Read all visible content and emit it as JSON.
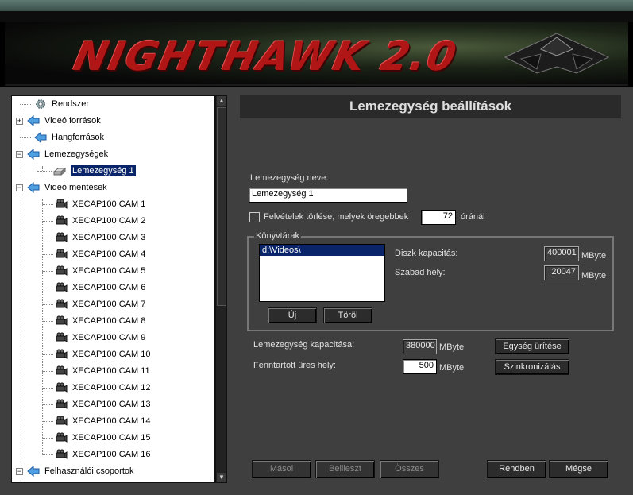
{
  "app": {
    "banner_title": "NIGHTHAWK 2.0"
  },
  "tree": {
    "items": [
      {
        "label": "Rendszer",
        "icon": "gear-icon",
        "expander": ""
      },
      {
        "label": "Videó források",
        "icon": "arrow-left-icon",
        "expander": "+"
      },
      {
        "label": "Hangforrások",
        "icon": "arrow-left-icon",
        "expander": ""
      },
      {
        "label": "Lemezegységek",
        "icon": "arrow-left-icon",
        "expander": "−"
      },
      {
        "label": "Lemezegység 1",
        "icon": "disk-icon",
        "expander": "",
        "selected": true
      },
      {
        "label": "Videó mentések",
        "icon": "arrow-left-icon",
        "expander": "−"
      },
      {
        "label": "XECAP100 CAM 1",
        "icon": "camera-icon"
      },
      {
        "label": "XECAP100 CAM 2",
        "icon": "camera-icon"
      },
      {
        "label": "XECAP100 CAM 3",
        "icon": "camera-icon"
      },
      {
        "label": "XECAP100 CAM 4",
        "icon": "camera-icon"
      },
      {
        "label": "XECAP100 CAM 5",
        "icon": "camera-icon"
      },
      {
        "label": "XECAP100 CAM 6",
        "icon": "camera-icon"
      },
      {
        "label": "XECAP100 CAM 7",
        "icon": "camera-icon"
      },
      {
        "label": "XECAP100 CAM 8",
        "icon": "camera-icon"
      },
      {
        "label": "XECAP100 CAM 9",
        "icon": "camera-icon"
      },
      {
        "label": "XECAP100 CAM 10",
        "icon": "camera-icon"
      },
      {
        "label": "XECAP100 CAM 11",
        "icon": "camera-icon"
      },
      {
        "label": "XECAP100 CAM 12",
        "icon": "camera-icon"
      },
      {
        "label": "XECAP100 CAM 13",
        "icon": "camera-icon"
      },
      {
        "label": "XECAP100 CAM 14",
        "icon": "camera-icon"
      },
      {
        "label": "XECAP100 CAM 15",
        "icon": "camera-icon"
      },
      {
        "label": "XECAP100 CAM 16",
        "icon": "camera-icon"
      },
      {
        "label": "Felhasználói csoportok",
        "icon": "arrow-left-icon",
        "expander": "−"
      }
    ]
  },
  "settings": {
    "header": "Lemezegység beállítások",
    "name_label": "Lemezegység neve:",
    "name_value": "Lemezegység 1",
    "delete_label": "Felvételek törlése, melyek öregebbek",
    "delete_hours": "72",
    "delete_unit": "óránál",
    "group_title": "Könyvtárak",
    "directories": [
      "d:\\Videos\\"
    ],
    "disk_capacity_label": "Diszk kapacitás:",
    "disk_capacity_value": "400001",
    "free_space_label": "Szabad hely:",
    "free_space_value": "20047",
    "unit_mbyte": "MByte",
    "new_button": "Új",
    "delete_button": "Töröl",
    "drive_capacity_label": "Lemezegység kapacitása:",
    "drive_capacity_value": "380000",
    "reserved_label": "Fenntartott üres hely:",
    "reserved_value": "500",
    "empty_button": "Egység ürítése",
    "sync_button": "Szinkronizálás"
  },
  "footer": {
    "copy": "Másol",
    "paste": "Beilleszt",
    "all": "Összes",
    "ok": "Rendben",
    "cancel": "Mégse"
  }
}
